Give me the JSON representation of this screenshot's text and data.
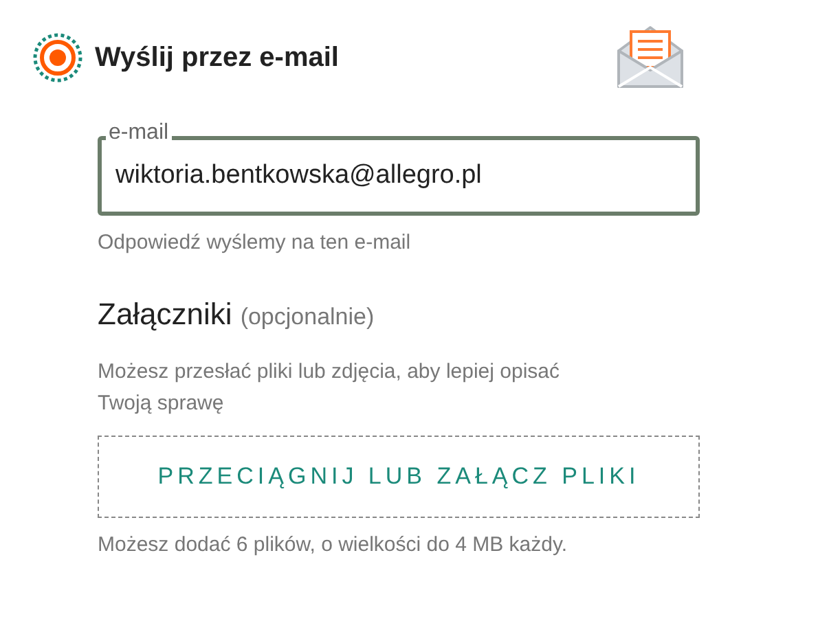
{
  "option": {
    "label": "Wyślij przez e-mail",
    "selected": true
  },
  "email_field": {
    "label": "e-mail",
    "value": "wiktoria.bentkowska@allegro.pl",
    "hint": "Odpowiedź wyślemy na ten e-mail"
  },
  "attachments": {
    "title": "Załączniki",
    "optional": "(opcjonalnie)",
    "description": "Możesz przesłać pliki lub zdjęcia, aby lepiej opisać Twoją sprawę",
    "button": "PRZECIĄGNIJ LUB ZAŁĄCZ PLIKI",
    "limit": "Możesz dodać 6 plików, o wielkości do 4 MB każdy."
  }
}
